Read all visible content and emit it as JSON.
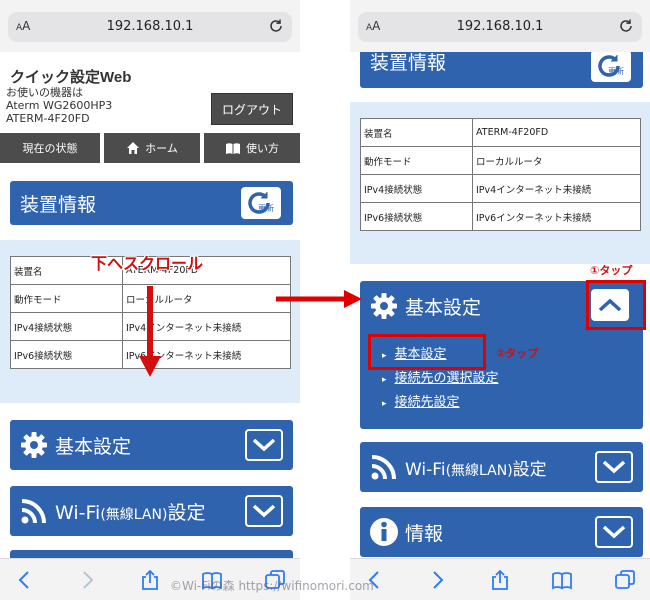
{
  "browser": {
    "url": "192.168.10.1",
    "aa_label": "AA"
  },
  "header": {
    "title": "クイック設定Web",
    "device_prefix": "お使いの機器は",
    "model": "Aterm WG2600HP3",
    "device_id": "ATERM-4F20FD",
    "logout_label": "ログアウト"
  },
  "nav": {
    "status": "現在の状態",
    "home": "ホーム",
    "howto": "使い方"
  },
  "device_info": {
    "title": "装置情報",
    "update_label": "更新",
    "rows": [
      {
        "key": "装置名",
        "value": "ATERM-4F20FD"
      },
      {
        "key": "動作モード",
        "value": "ローカルルータ"
      },
      {
        "key": "IPv4接続状態",
        "value": "IPv4インターネット未接続"
      },
      {
        "key": "IPv6接続状態",
        "value": "IPv6インターネット未接続"
      }
    ]
  },
  "menu": {
    "basic": "基本設定",
    "wifi_main": "Wi-Fi",
    "wifi_paren": "(無線LAN)",
    "wifi_suffix": "設定",
    "info": "情報",
    "basic_sub": [
      "基本設定",
      "接続先の選択設定",
      "接続先設定"
    ]
  },
  "annotations": {
    "scroll": "下へスクロール",
    "tap1": "①タップ",
    "tap2": "②タップ",
    "watermark": "©Wi-Fiの森 https://wifinomori.com"
  },
  "colors": {
    "panel_blue": "#2f63ad",
    "info_bg": "#deebf8",
    "dark_button": "#4c4c4c",
    "annotation_red": "#e00000"
  },
  "icons": [
    "reload-icon",
    "update-icon",
    "gear-icon",
    "wifi-icon",
    "info-icon",
    "chevron-down-icon",
    "chevron-up-icon",
    "home-icon",
    "book-icon",
    "back-icon",
    "forward-icon",
    "share-icon",
    "bookmarks-icon",
    "tabs-icon"
  ]
}
